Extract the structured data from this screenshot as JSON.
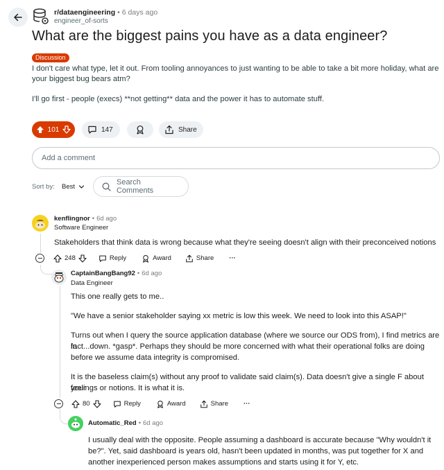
{
  "header": {
    "subreddit": "r/dataengineering",
    "sep": "•",
    "time": "6 days ago",
    "op_user": "engineer_of-sorts"
  },
  "post": {
    "title": "What are the biggest pains you have as a data engineer?",
    "flair": "Discussion",
    "body_line1": "I don't care what type, let it out. From tooling annoyances to just wanting to be able to take a bit more holiday, what are",
    "body_line2": "your biggest bug bears atm?",
    "body_line3": "I'll go first - people (execs) **not getting** data and the power it has to automate stuff.",
    "votes": "101",
    "comments": "147",
    "share_label": "Share"
  },
  "comment_box": {
    "placeholder": "Add a comment"
  },
  "sort": {
    "label": "Sort by:",
    "value": "Best",
    "search_label": "Search Comments"
  },
  "comments": [
    {
      "author": "kenflingnor",
      "sep": "•",
      "time": "6d ago",
      "flair": "Software Engineer",
      "lines": [
        "Stakeholders that think data is wrong because what they're seeing doesn't align with their preconceived notions"
      ],
      "votes": "248",
      "reply": "Reply",
      "award": "Award",
      "share": "Share",
      "more": "···"
    },
    {
      "author": "CaptainBangBang92",
      "sep": "•",
      "time": "6d ago",
      "flair": "Data Engineer",
      "p1": "This one really gets to me..",
      "p2": "\"We have a senior stakeholder saying xx metric is low this week. We need to look into this ASAP!\"",
      "p3_l1": "Turns out when I query the source application database (where we source our ODS from), I find metrics are in",
      "p3_l2": "fact...down. *gasp*. Perhaps they should be more concerned with what their operational folks are doing",
      "p3_l3": "before we assume data integrity is compromised.",
      "p4_l1": "It is the baseless claim(s) without any proof to validate said claim(s). Data doesn't give a single F about your",
      "p4_l2": "feelings or notions. It is what it is.",
      "votes": "80",
      "reply": "Reply",
      "award": "Award",
      "share": "Share",
      "more": "···"
    },
    {
      "author": "Automatic_Red",
      "sep": "•",
      "time": "6d ago",
      "l1": "I usually deal with the opposite. People assuming a dashboard is accurate because \"Why wouldn't it",
      "l2": "be?\". Yet, said dashboard is years old, hasn't been updated in months, was put together for X and",
      "l3": "another inexperienced person makes assumptions and starts using it for Y, etc."
    }
  ],
  "colors": {
    "accent": "#d93a00",
    "pill_bg": "#eef1f3",
    "text": "#1c1c1c",
    "muted": "#5c6c74"
  }
}
